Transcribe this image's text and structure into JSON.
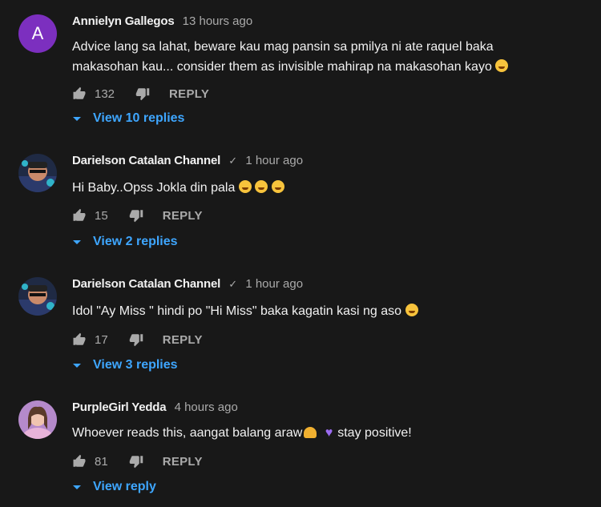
{
  "comments": [
    {
      "avatar_letter": "A",
      "author": "Annielyn Gallegos",
      "time": "13 hours ago",
      "text_line1": "Advice lang sa lahat, beware kau mag pansin sa pmilya ni ate raquel baka",
      "text_line2": "makasohan kau... consider them as invisible mahirap na makasohan kayo",
      "likes": "132",
      "reply_label": "REPLY",
      "view_replies": "View 10 replies"
    },
    {
      "author": "Darielson Catalan Channel",
      "verified": "✓",
      "time": "1 hour ago",
      "text": "Hi Baby..Opss Jokla din pala",
      "likes": "15",
      "reply_label": "REPLY",
      "view_replies": "View 2 replies"
    },
    {
      "author": "Darielson Catalan Channel",
      "verified": "✓",
      "time": "1 hour ago",
      "text": "Idol \"Ay Miss \" hindi po \"Hi Miss\" baka kagatin kasi ng aso",
      "likes": "17",
      "reply_label": "REPLY",
      "view_replies": "View 3 replies"
    },
    {
      "author": "PurpleGirl Yedda",
      "time": "4 hours ago",
      "text_a": "Whoever reads this, aangat balang araw",
      "text_b": "stay positive!",
      "likes": "81",
      "reply_label": "REPLY",
      "view_replies": "View reply"
    }
  ],
  "colors": {
    "background": "#181818",
    "link": "#3ea6ff",
    "secondary": "#aaaaaa",
    "avatar_a": "#7c2fbf"
  },
  "icons": [
    "thumb-up-icon",
    "thumb-down-icon",
    "caret-down-icon",
    "verified-check-icon"
  ]
}
